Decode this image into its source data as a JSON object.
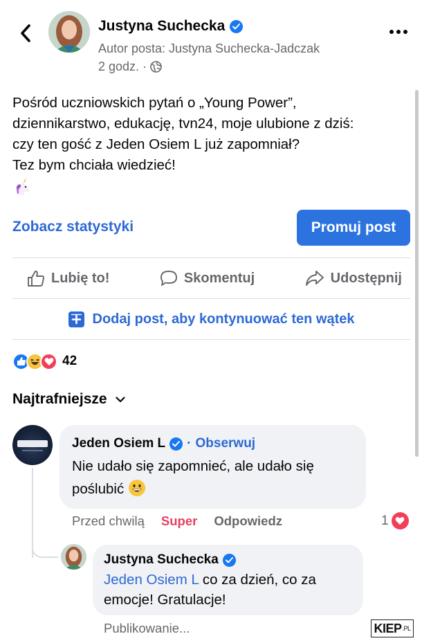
{
  "header": {
    "author_name": "Justyna Suchecka",
    "author_subtitle": "Autor posta: Justyna Suchecka-Jadczak",
    "time": "2 godz. ·",
    "icons": {
      "back": "chevron-left-icon",
      "verified": "verified-badge-icon",
      "privacy": "globe-icon",
      "more": "more-options-icon"
    }
  },
  "post": {
    "lines": [
      "Pośród uczniowskich pytań o „Young Power”,",
      "dziennikarstwo, edukację, tvn24, moje ulubione z dziś:",
      "czy ten gość z Jeden Osiem L już zapomniał?",
      "Tez bym chciała wiedzieć!"
    ],
    "emoji": "unicorn-emoji"
  },
  "stats_link": "Zobacz statystyki",
  "promote_button": "Promuj post",
  "actions": {
    "like": "Lubię to!",
    "comment": "Skomentuj",
    "share": "Udostępnij"
  },
  "add_post": "Dodaj post, aby kontynuować ten wątek",
  "reactions": {
    "types": [
      "like",
      "haha",
      "love"
    ],
    "count": "42"
  },
  "sort_label": "Najtrafniejsze",
  "comments": [
    {
      "author": "Jeden Osiem L",
      "separator": "·",
      "follow": "Obserwuj",
      "lines": [
        "Nie udało się zapomnieć, ale udało się",
        "poślubić"
      ],
      "emoji": "grinning-face-emoji",
      "time": "Przed chwilą",
      "reaction_label": "Super",
      "reply_label": "Odpowiedz",
      "reaction_count": "1",
      "avatar_text": "JEDENOSIEML"
    },
    {
      "author": "Justyna Suchecka",
      "mention": "Jeden Osiem L",
      "line1_rest": " co za dzień, co za",
      "line2": "emocje! Gratulacje!",
      "status": "Publikowanie..."
    }
  ],
  "watermark": {
    "main": "KIEP",
    "suffix": ".PL"
  },
  "colors": {
    "link_blue": "#2d69d4",
    "button_blue": "#2c73e0",
    "secondary_text": "#65676b",
    "bubble_bg": "#f0f2f5",
    "super_red": "#e4405f",
    "verified_blue": "#1877f2"
  }
}
